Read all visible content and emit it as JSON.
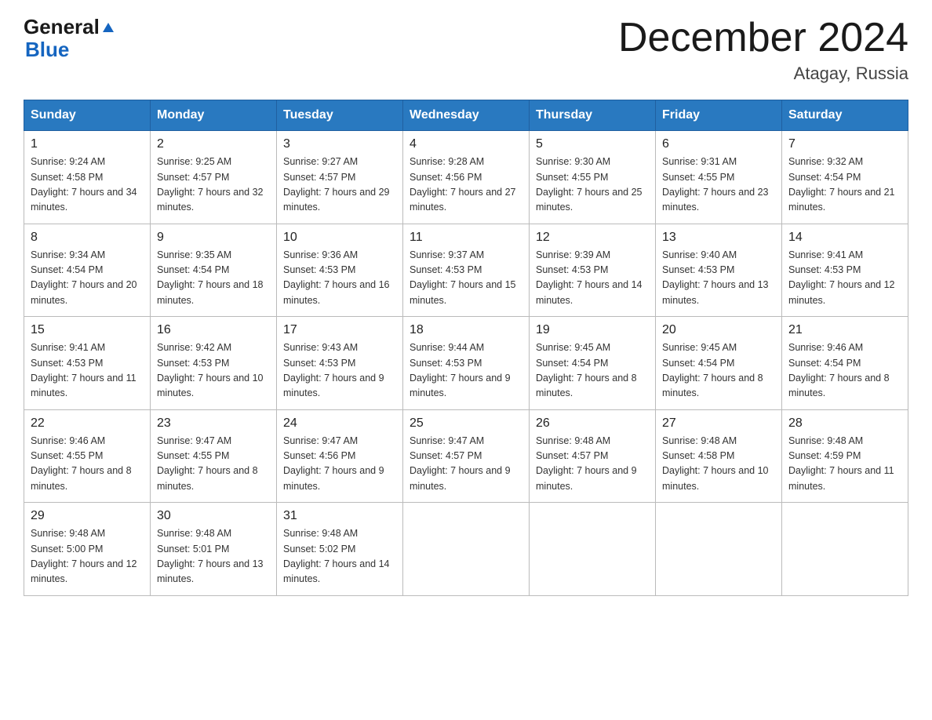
{
  "header": {
    "logo_general": "General",
    "logo_blue": "Blue",
    "title": "December 2024",
    "location": "Atagay, Russia"
  },
  "days_of_week": [
    "Sunday",
    "Monday",
    "Tuesday",
    "Wednesday",
    "Thursday",
    "Friday",
    "Saturday"
  ],
  "weeks": [
    [
      {
        "day": "1",
        "sunrise": "9:24 AM",
        "sunset": "4:58 PM",
        "daylight": "7 hours and 34 minutes."
      },
      {
        "day": "2",
        "sunrise": "9:25 AM",
        "sunset": "4:57 PM",
        "daylight": "7 hours and 32 minutes."
      },
      {
        "day": "3",
        "sunrise": "9:27 AM",
        "sunset": "4:57 PM",
        "daylight": "7 hours and 29 minutes."
      },
      {
        "day": "4",
        "sunrise": "9:28 AM",
        "sunset": "4:56 PM",
        "daylight": "7 hours and 27 minutes."
      },
      {
        "day": "5",
        "sunrise": "9:30 AM",
        "sunset": "4:55 PM",
        "daylight": "7 hours and 25 minutes."
      },
      {
        "day": "6",
        "sunrise": "9:31 AM",
        "sunset": "4:55 PM",
        "daylight": "7 hours and 23 minutes."
      },
      {
        "day": "7",
        "sunrise": "9:32 AM",
        "sunset": "4:54 PM",
        "daylight": "7 hours and 21 minutes."
      }
    ],
    [
      {
        "day": "8",
        "sunrise": "9:34 AM",
        "sunset": "4:54 PM",
        "daylight": "7 hours and 20 minutes."
      },
      {
        "day": "9",
        "sunrise": "9:35 AM",
        "sunset": "4:54 PM",
        "daylight": "7 hours and 18 minutes."
      },
      {
        "day": "10",
        "sunrise": "9:36 AM",
        "sunset": "4:53 PM",
        "daylight": "7 hours and 16 minutes."
      },
      {
        "day": "11",
        "sunrise": "9:37 AM",
        "sunset": "4:53 PM",
        "daylight": "7 hours and 15 minutes."
      },
      {
        "day": "12",
        "sunrise": "9:39 AM",
        "sunset": "4:53 PM",
        "daylight": "7 hours and 14 minutes."
      },
      {
        "day": "13",
        "sunrise": "9:40 AM",
        "sunset": "4:53 PM",
        "daylight": "7 hours and 13 minutes."
      },
      {
        "day": "14",
        "sunrise": "9:41 AM",
        "sunset": "4:53 PM",
        "daylight": "7 hours and 12 minutes."
      }
    ],
    [
      {
        "day": "15",
        "sunrise": "9:41 AM",
        "sunset": "4:53 PM",
        "daylight": "7 hours and 11 minutes."
      },
      {
        "day": "16",
        "sunrise": "9:42 AM",
        "sunset": "4:53 PM",
        "daylight": "7 hours and 10 minutes."
      },
      {
        "day": "17",
        "sunrise": "9:43 AM",
        "sunset": "4:53 PM",
        "daylight": "7 hours and 9 minutes."
      },
      {
        "day": "18",
        "sunrise": "9:44 AM",
        "sunset": "4:53 PM",
        "daylight": "7 hours and 9 minutes."
      },
      {
        "day": "19",
        "sunrise": "9:45 AM",
        "sunset": "4:54 PM",
        "daylight": "7 hours and 8 minutes."
      },
      {
        "day": "20",
        "sunrise": "9:45 AM",
        "sunset": "4:54 PM",
        "daylight": "7 hours and 8 minutes."
      },
      {
        "day": "21",
        "sunrise": "9:46 AM",
        "sunset": "4:54 PM",
        "daylight": "7 hours and 8 minutes."
      }
    ],
    [
      {
        "day": "22",
        "sunrise": "9:46 AM",
        "sunset": "4:55 PM",
        "daylight": "7 hours and 8 minutes."
      },
      {
        "day": "23",
        "sunrise": "9:47 AM",
        "sunset": "4:55 PM",
        "daylight": "7 hours and 8 minutes."
      },
      {
        "day": "24",
        "sunrise": "9:47 AM",
        "sunset": "4:56 PM",
        "daylight": "7 hours and 9 minutes."
      },
      {
        "day": "25",
        "sunrise": "9:47 AM",
        "sunset": "4:57 PM",
        "daylight": "7 hours and 9 minutes."
      },
      {
        "day": "26",
        "sunrise": "9:48 AM",
        "sunset": "4:57 PM",
        "daylight": "7 hours and 9 minutes."
      },
      {
        "day": "27",
        "sunrise": "9:48 AM",
        "sunset": "4:58 PM",
        "daylight": "7 hours and 10 minutes."
      },
      {
        "day": "28",
        "sunrise": "9:48 AM",
        "sunset": "4:59 PM",
        "daylight": "7 hours and 11 minutes."
      }
    ],
    [
      {
        "day": "29",
        "sunrise": "9:48 AM",
        "sunset": "5:00 PM",
        "daylight": "7 hours and 12 minutes."
      },
      {
        "day": "30",
        "sunrise": "9:48 AM",
        "sunset": "5:01 PM",
        "daylight": "7 hours and 13 minutes."
      },
      {
        "day": "31",
        "sunrise": "9:48 AM",
        "sunset": "5:02 PM",
        "daylight": "7 hours and 14 minutes."
      },
      null,
      null,
      null,
      null
    ]
  ],
  "labels": {
    "sunrise": "Sunrise:",
    "sunset": "Sunset:",
    "daylight": "Daylight:"
  }
}
